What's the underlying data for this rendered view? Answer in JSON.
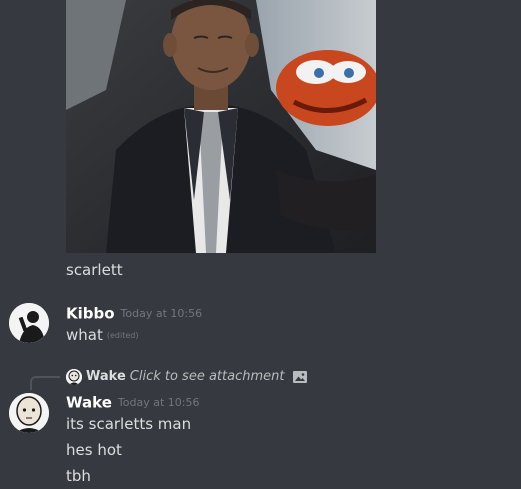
{
  "messages": [
    {
      "caption": "scarlett"
    },
    {
      "username": "Kibbo",
      "timestamp": "Today at 10:56",
      "text": "what",
      "edited_label": "(edited)"
    },
    {
      "reply": {
        "username": "Wake",
        "link_text": "Click to see attachment"
      },
      "username": "Wake",
      "timestamp": "Today at 10:56",
      "lines": [
        "its scarletts man",
        "hes hot",
        "tbh"
      ]
    }
  ],
  "colors": {
    "background": "#36393f",
    "text": "#dcddde",
    "username": "#ffffff",
    "timestamp": "#72767d"
  },
  "icons": {
    "reply_attachment": "image-icon"
  }
}
